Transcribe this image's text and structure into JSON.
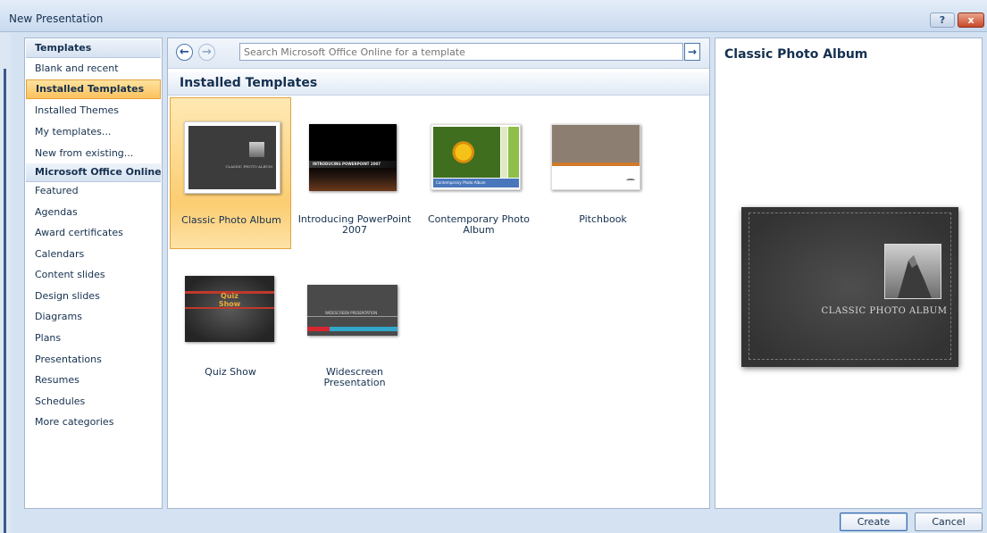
{
  "window": {
    "title": "New Presentation",
    "help_label": "?",
    "close_label": "x"
  },
  "nav": {
    "header_templates": "Templates",
    "items_top": [
      "Blank and recent",
      "Installed Templates",
      "Installed Themes",
      "My templates...",
      "New from existing..."
    ],
    "header_online": "Microsoft Office Online",
    "items_online": [
      "Featured",
      "Agendas",
      "Award certificates",
      "Calendars",
      "Content slides",
      "Design slides",
      "Diagrams",
      "Plans",
      "Presentations",
      "Resumes",
      "Schedules",
      "More categories"
    ],
    "selected": "Installed Templates"
  },
  "toolbar": {
    "back_icon": "←",
    "forward_icon": "→",
    "search_placeholder": "Search Microsoft Office Online for a template",
    "go_icon": "→"
  },
  "section": {
    "title": "Installed Templates"
  },
  "templates": [
    {
      "label": "Classic Photo Album",
      "thumb_text": "CLASSIC PHOTO ALBUM",
      "selected": true
    },
    {
      "label": "Introducing PowerPoint 2007",
      "thumb_text": "INTRODUCING POWERPOINT 2007"
    },
    {
      "label": "Contemporary Photo Album",
      "thumb_text": "Contemporary Photo Album"
    },
    {
      "label": "Pitchbook",
      "thumb_text": ""
    },
    {
      "label": "Quiz Show",
      "thumb_text": "Quiz Show"
    },
    {
      "label": "Widescreen Presentation",
      "thumb_text": "WIDESCREEN PRESENTATION"
    }
  ],
  "preview": {
    "title": "Classic Photo Album",
    "caption": "CLASSIC PHOTO ALBUM"
  },
  "buttons": {
    "create": "Create",
    "cancel": "Cancel"
  }
}
